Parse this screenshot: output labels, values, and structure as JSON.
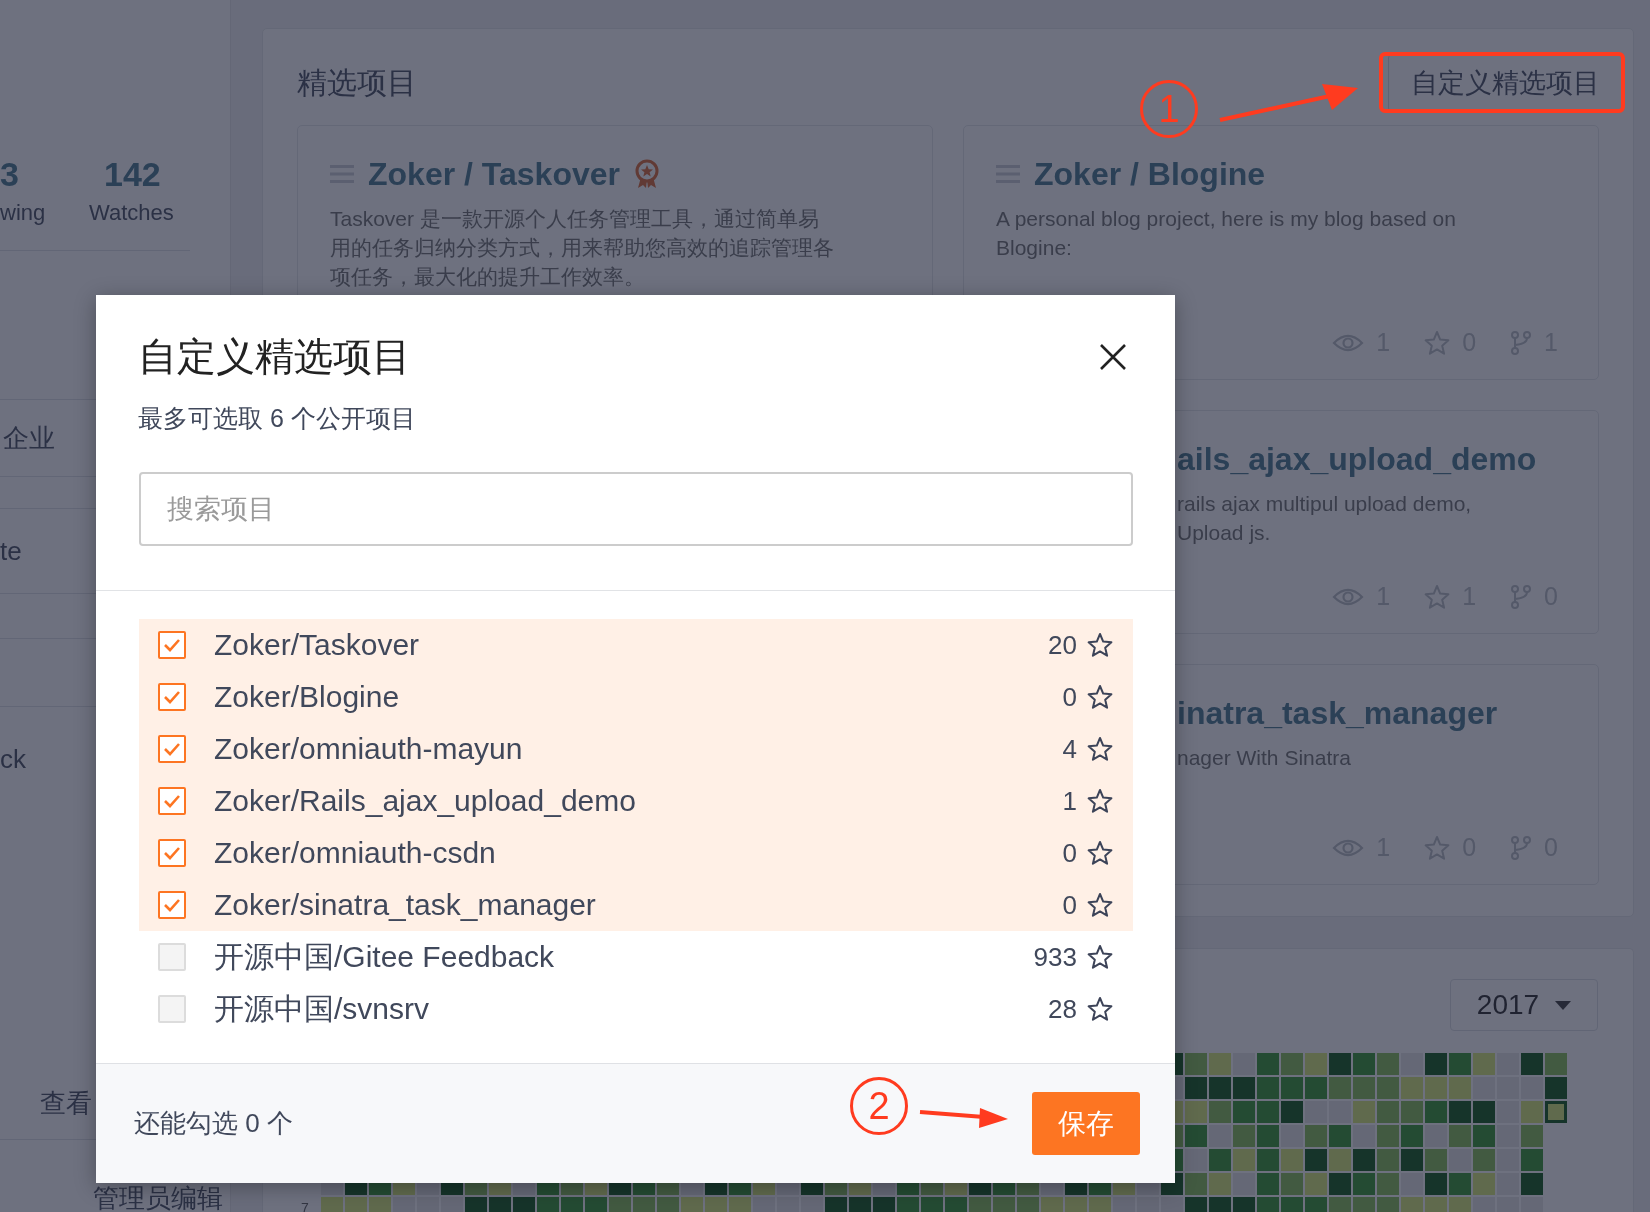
{
  "sidebar": {
    "stats": [
      {
        "value": "3",
        "label": "wing"
      },
      {
        "value": "142",
        "label": "Watches"
      }
    ],
    "menu": [
      {
        "label": "企业"
      },
      {
        "label": "te"
      },
      {
        "label": "ck"
      }
    ],
    "view_link": "查看",
    "admin_edit": "管理员编辑"
  },
  "featured": {
    "title": "精选项目",
    "customize_button": "自定义精选项目",
    "columns": [
      [
        {
          "kind": "full",
          "title": "Zoker / Taskover",
          "recommended": true,
          "description_lines": [
            "Taskover 是一款开源个人任务管理工具，通过简单易",
            "用的任务归纳分类方式，用来帮助您高效的追踪管理各",
            "项任务，最大化的提升工作效率。"
          ]
        }
      ],
      [
        {
          "kind": "full",
          "title": "Zoker / Blogine",
          "recommended": false,
          "description_lines": [
            "A personal blog project, here is my blog based on",
            "Blogine:"
          ],
          "stats": {
            "watches": "1",
            "star_count": "0",
            "forks": "1"
          }
        },
        {
          "kind": "covered",
          "title": "ails_ajax_upload_demo",
          "recommended": false,
          "description_lines": [
            "rails ajax multipul upload demo,",
            "Upload js."
          ],
          "stats": {
            "watches": "1",
            "star_count": "1",
            "forks": "0"
          }
        },
        {
          "kind": "covered",
          "title": "inatra_task_manager",
          "recommended": false,
          "description_lines": [
            "nager With Sinatra"
          ],
          "stats": {
            "watches": "1",
            "star_count": "0",
            "forks": "0"
          }
        }
      ]
    ]
  },
  "contributions": {
    "year": "2017",
    "row_labels": [
      "7"
    ]
  },
  "modal": {
    "title": "自定义精选项目",
    "subtitle": "最多可选取 6 个公开项目",
    "search": {
      "placeholder": "搜索项目"
    },
    "projects": [
      {
        "name": "Zoker/Taskover",
        "star_count": "20",
        "checked": true
      },
      {
        "name": "Zoker/Blogine",
        "star_count": "0",
        "checked": true
      },
      {
        "name": "Zoker/omniauth-mayun",
        "star_count": "4",
        "checked": true
      },
      {
        "name": "Zoker/Rails_ajax_upload_demo",
        "star_count": "1",
        "checked": true
      },
      {
        "name": "Zoker/omniauth-csdn",
        "star_count": "0",
        "checked": true
      },
      {
        "name": "Zoker/sinatra_task_manager",
        "star_count": "0",
        "checked": true
      },
      {
        "name": "开源中国/Gitee Feedback",
        "star_count": "933",
        "checked": false
      },
      {
        "name": "开源中国/svnsrv",
        "star_count": "28",
        "checked": false
      }
    ],
    "remaining": "还能勾选 0 个",
    "save_button": "保存"
  },
  "annotations": [
    {
      "number": "1",
      "highlight_frame": true
    },
    {
      "number": "2",
      "highlight_frame": false
    }
  ]
}
